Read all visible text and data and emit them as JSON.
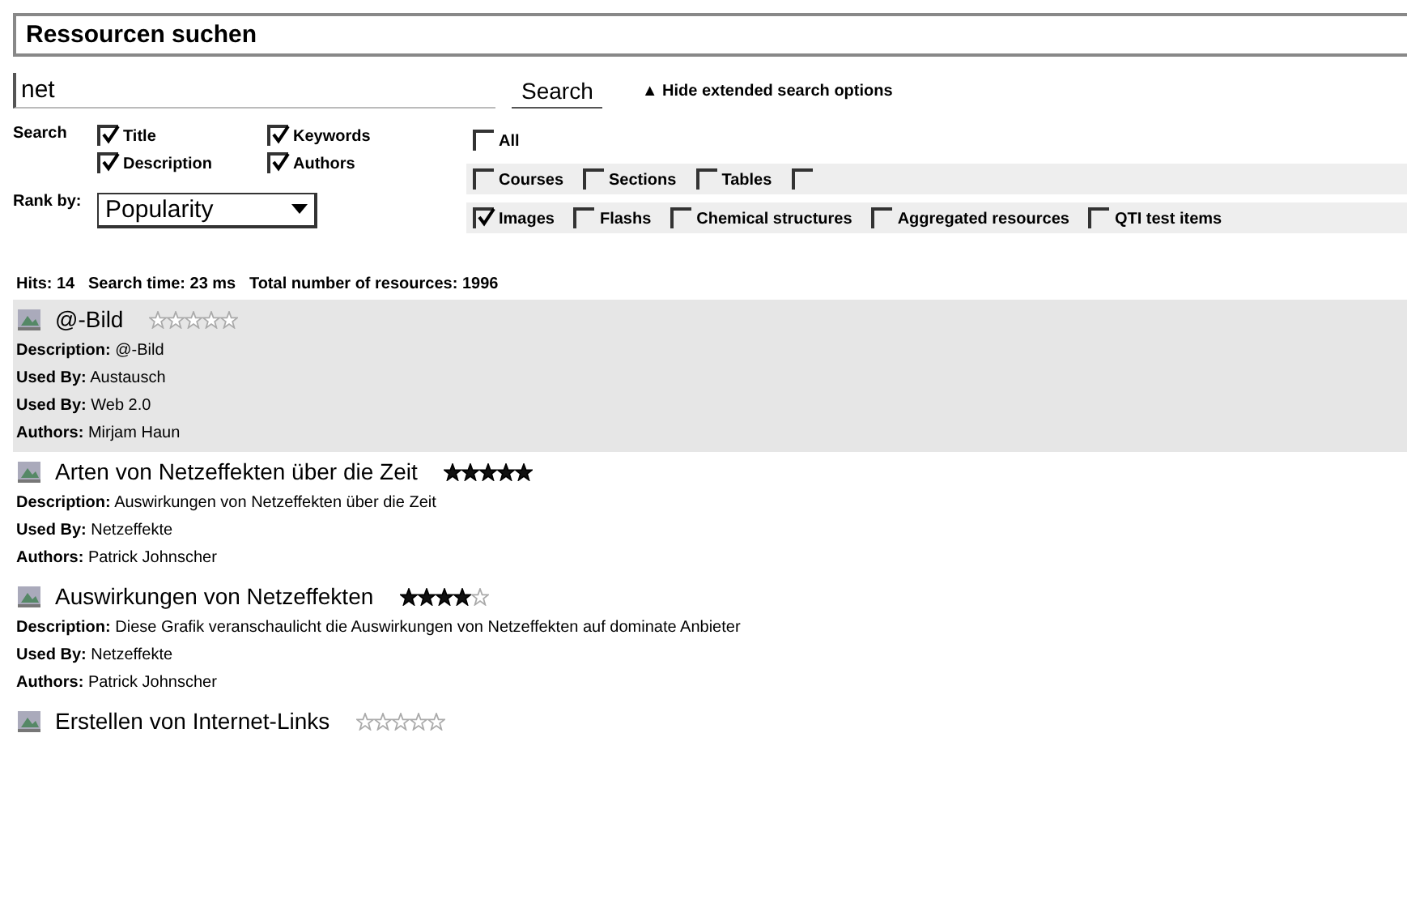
{
  "title": "Ressourcen suchen",
  "search": {
    "value": "net",
    "button": "Search",
    "toggle_icon": "▲",
    "toggle": "Hide extended search options"
  },
  "search_in": {
    "label": "Search",
    "options": [
      {
        "label": "Title",
        "checked": true
      },
      {
        "label": "Keywords",
        "checked": true
      },
      {
        "label": "Description",
        "checked": true
      },
      {
        "label": "Authors",
        "checked": true
      }
    ]
  },
  "rank": {
    "label": "Rank by:",
    "value": "Popularity"
  },
  "types": [
    [
      {
        "label": "All",
        "checked": false
      }
    ],
    [
      {
        "label": "Courses",
        "checked": false
      },
      {
        "label": "Sections",
        "checked": false
      },
      {
        "label": "Tables",
        "checked": false
      },
      {
        "checked": false
      }
    ],
    [
      {
        "label": "Images",
        "checked": true
      },
      {
        "label": "Flashs",
        "checked": false
      },
      {
        "label": "Chemical structures",
        "checked": false
      },
      {
        "label": "Aggregated resources",
        "checked": false
      },
      {
        "label": "QTI test items",
        "checked": false
      }
    ]
  ],
  "stats": "Hits: 14   Search time: 23 ms   Total number of resources: 1996",
  "results": [
    {
      "title": "@-Bild",
      "stars": 0,
      "selected": true,
      "fields": [
        {
          "label": "Description:",
          "value": "@-Bild"
        },
        {
          "label": "Used By:",
          "value": "Austausch"
        },
        {
          "label": "Used By:",
          "value": "Web 2.0"
        },
        {
          "label": "Authors:",
          "value": "Mirjam Haun"
        }
      ]
    },
    {
      "title": "Arten von Netzeffekten über die Zeit",
      "stars": 5,
      "selected": false,
      "fields": [
        {
          "label": "Description:",
          "value": "Auswirkungen von Netzeffekten über die Zeit"
        },
        {
          "label": "Used By:",
          "value": "Netzeffekte"
        },
        {
          "label": "Authors:",
          "value": "Patrick Johnscher"
        }
      ]
    },
    {
      "title": "Auswirkungen von Netzeffekten",
      "stars": 4,
      "selected": false,
      "fields": [
        {
          "label": "Description:",
          "value": "Diese Grafik veranschaulicht die Auswirkungen von Netzeffekten auf dominate Anbieter"
        },
        {
          "label": "Used By:",
          "value": "Netzeffekte"
        },
        {
          "label": "Authors:",
          "value": "Patrick Johnscher"
        }
      ]
    },
    {
      "title": "Erstellen von Internet-Links",
      "stars": 0,
      "selected": false
    }
  ]
}
